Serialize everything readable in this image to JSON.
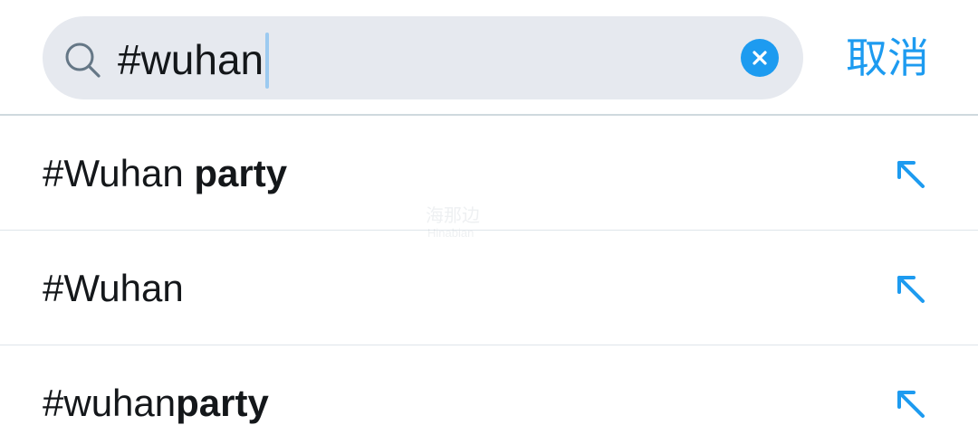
{
  "search": {
    "query": "#wuhan",
    "icon": "search-icon",
    "clear_icon": "clear-icon"
  },
  "cancel_label": "取消",
  "suggestions": [
    {
      "prefix": "#Wuhan ",
      "bold": "party",
      "icon": "fill-arrow-icon"
    },
    {
      "prefix": "#Wuhan",
      "bold": "",
      "icon": "fill-arrow-icon"
    },
    {
      "prefix": "#wuhan",
      "bold": "party",
      "icon": "fill-arrow-icon"
    }
  ],
  "watermark": {
    "cn": "海那边",
    "en": "Hinabian"
  },
  "colors": {
    "accent": "#1d9bf0",
    "search_bg": "#e6e9ef",
    "text": "#14171a",
    "divider": "#dfe5ea"
  }
}
